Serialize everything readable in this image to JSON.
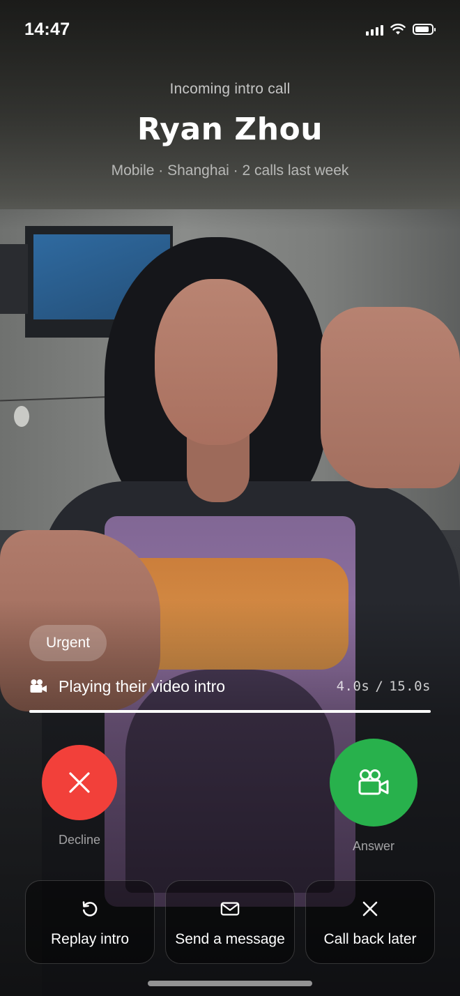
{
  "status_bar": {
    "time": "14:47",
    "signal_bars_filled": 4,
    "wifi_icon": "wifi-icon",
    "battery_level": 0.85
  },
  "caller": {
    "eyebrow": "Incoming intro call",
    "name": "Ryan Zhou",
    "meta": "Mobile · Shanghai · 2 calls last week"
  },
  "intro": {
    "badge": "Urgent",
    "icon": "video-camera-icon",
    "label": "Playing their video intro",
    "elapsed": "4.0s",
    "separator": "/",
    "duration": "15.0s",
    "progress": 1.0
  },
  "call_actions": {
    "decline_label": "Decline",
    "decline_icon": "close-icon",
    "answer_label": "Answer",
    "answer_icon": "video-camera-icon"
  },
  "quick_actions": [
    {
      "label": "Replay intro",
      "icon": "replay-icon"
    },
    {
      "label": "Send a message",
      "icon": "envelope-icon"
    },
    {
      "label": "Call back later",
      "icon": "close-icon"
    }
  ],
  "colors": {
    "decline": "#f2403a",
    "answer": "#28b14c"
  }
}
